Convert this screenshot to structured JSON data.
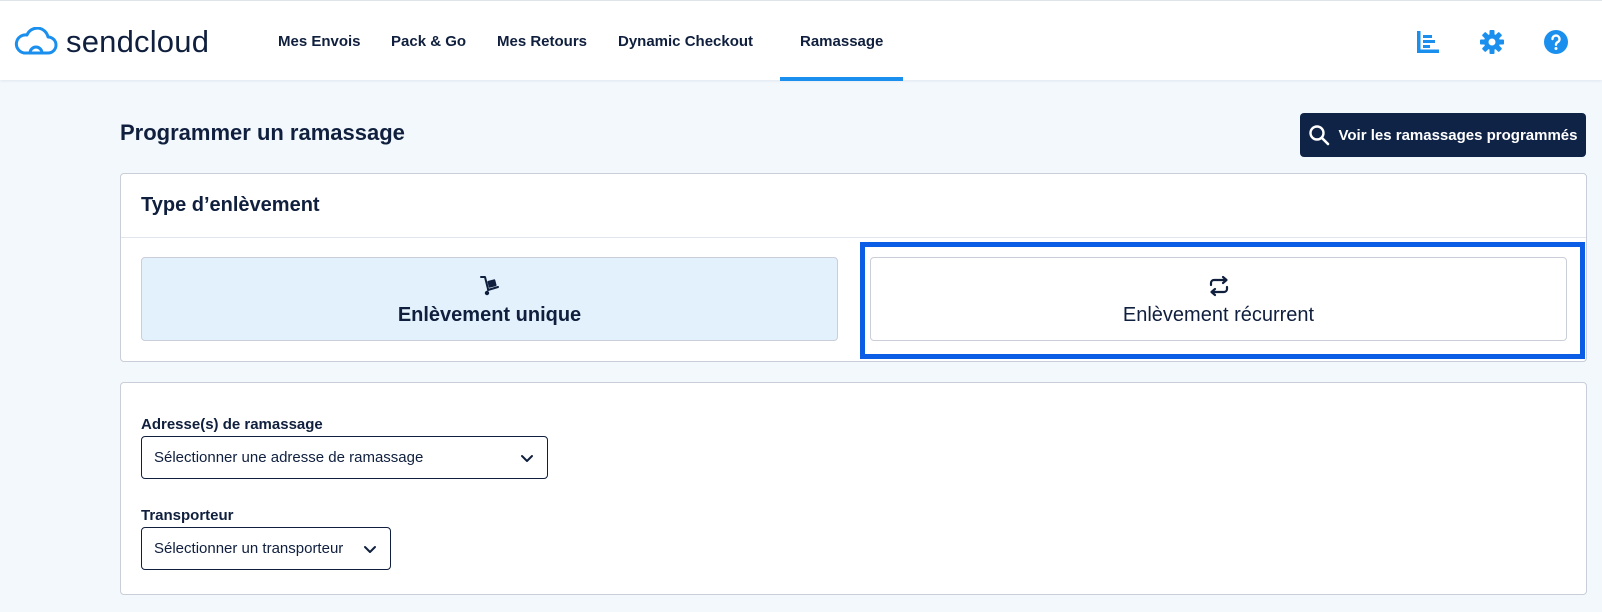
{
  "app": {
    "name": "sendcloud"
  },
  "nav": {
    "items": [
      {
        "label": "Mes Envois"
      },
      {
        "label": "Pack & Go"
      },
      {
        "label": "Mes Retours"
      },
      {
        "label": "Dynamic Checkout"
      },
      {
        "label": "Ramassage",
        "active": true
      }
    ]
  },
  "header_icons": [
    "analytics-icon",
    "gear-icon",
    "help-icon"
  ],
  "page": {
    "title": "Programmer un ramassage",
    "view_scheduled_button": "Voir les ramassages programmés"
  },
  "pickup_type": {
    "heading": "Type d’enlèvement",
    "options": [
      {
        "label": "Enlèvement unique",
        "icon": "hand-truck-icon",
        "selected": true
      },
      {
        "label": "Enlèvement récurrent",
        "icon": "repeat-icon",
        "selected": false,
        "focused": true
      }
    ]
  },
  "form": {
    "address_label": "Adresse(s) de ramassage",
    "address_placeholder": "Sélectionner une adresse de ramassage",
    "carrier_label": "Transporteur",
    "carrier_placeholder": "Sélectionner un transporteur"
  },
  "colors": {
    "brand_blue": "#1a8fee",
    "navy": "#0f2347",
    "selected_bg": "#e3f1fc",
    "focus_ring": "#0b5de6",
    "page_bg": "#f3f8fd"
  }
}
